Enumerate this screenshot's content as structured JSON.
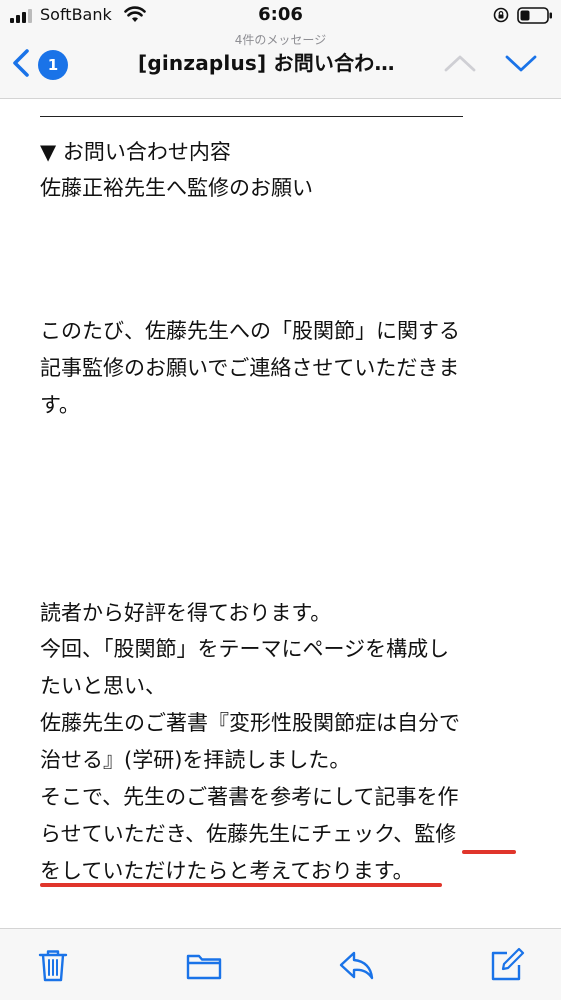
{
  "status_bar": {
    "carrier": "SoftBank",
    "time": "6:06"
  },
  "nav": {
    "unread_count": "1",
    "message_count": "4件のメッセージ",
    "title": "[ginzaplus] お問い合わ…"
  },
  "mail": {
    "lines": [
      "▼ お問い合わせ内容",
      "佐藤正裕先生へ監修のお願い",
      "このたび、佐藤先生への「股関節」に関する",
      "記事監修のお願いでご連絡させていただきま",
      "す。",
      "読者から好評を得ております。",
      "今回、「股関節」をテーマにページを構成し",
      "たいと思い、",
      "佐藤先生のご著書『変形性股関節症は自分で",
      "治せる』(学研)を拝読しました。",
      "そこで、先生のご著書を参考にして記事を作",
      "らせていただき、佐藤先生にチェック、監修",
      "をしていただけたらと考えております。"
    ]
  },
  "toolbar": {
    "trash_icon": "trash-icon",
    "folder_icon": "folder-icon",
    "reply_icon": "reply-icon",
    "compose_icon": "compose-icon"
  },
  "colors": {
    "accent": "#1a73e8",
    "highlight_underline": "#e0352b"
  }
}
